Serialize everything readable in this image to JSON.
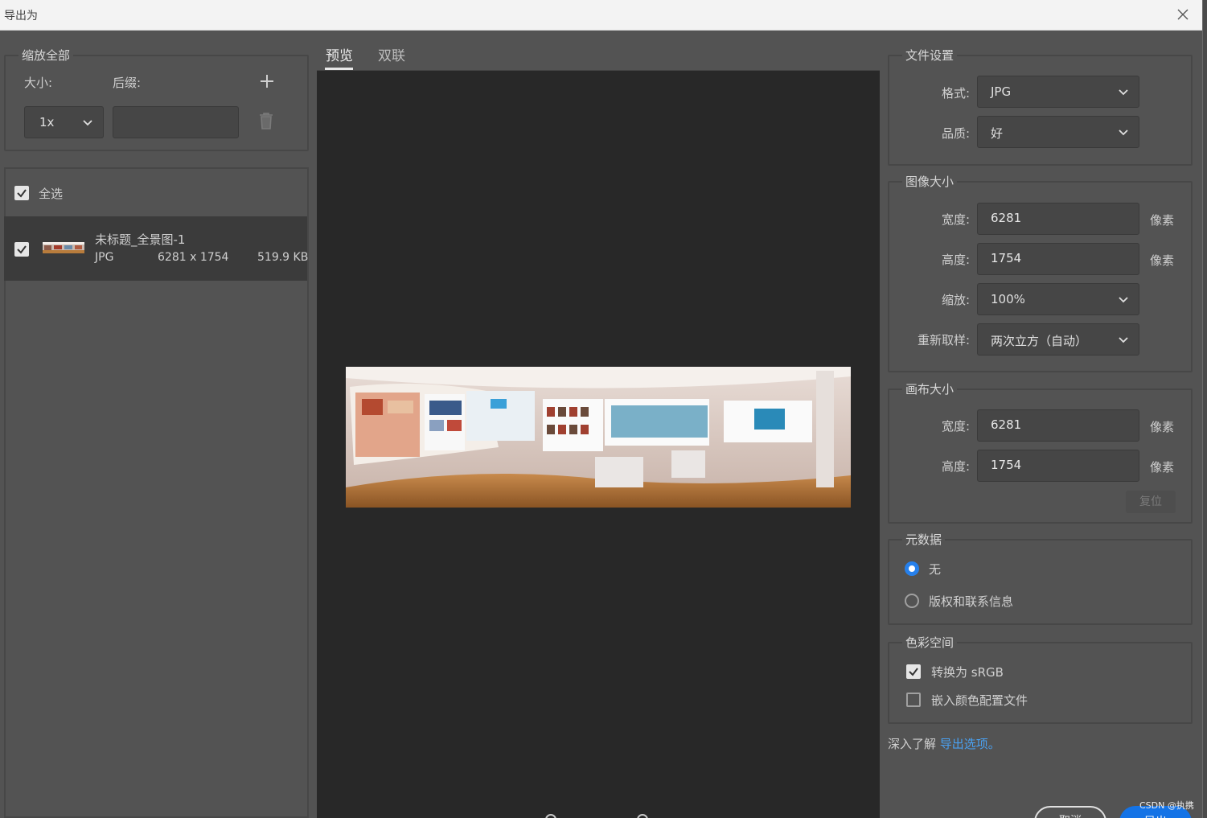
{
  "window": {
    "title": "导出为"
  },
  "scale_all": {
    "legend": "缩放全部",
    "size_label": "大小:",
    "suffix_label": "后缀:",
    "size_value": "1x",
    "suffix_value": ""
  },
  "assets": {
    "select_all_label": "全选",
    "select_all_checked": true,
    "items": [
      {
        "name": "未标题_全景图-1",
        "format": "JPG",
        "dimensions": "6281 x 1754",
        "filesize": "519.9 KB",
        "checked": true
      }
    ]
  },
  "tabs": [
    {
      "label": "预览",
      "active": true
    },
    {
      "label": "双联",
      "active": false
    }
  ],
  "file_settings": {
    "legend": "文件设置",
    "format_label": "格式:",
    "format_value": "JPG",
    "quality_label": "品质:",
    "quality_value": "好"
  },
  "image_size": {
    "legend": "图像大小",
    "width_label": "宽度:",
    "width_value": "6281",
    "height_label": "高度:",
    "height_value": "1754",
    "unit": "像素",
    "scale_label": "缩放:",
    "scale_value": "100%",
    "resample_label": "重新取样:",
    "resample_value": "两次立方（自动）"
  },
  "canvas_size": {
    "legend": "画布大小",
    "width_label": "宽度:",
    "width_value": "6281",
    "height_label": "高度:",
    "height_value": "1754",
    "unit": "像素",
    "reset_label": "复位"
  },
  "metadata": {
    "legend": "元数据",
    "options": [
      {
        "label": "无",
        "selected": true
      },
      {
        "label": "版权和联系信息",
        "selected": false
      }
    ]
  },
  "color_space": {
    "legend": "色彩空间",
    "convert_srgb_label": "转换为 sRGB",
    "convert_srgb_checked": true,
    "embed_profile_label": "嵌入颜色配置文件",
    "embed_profile_checked": false
  },
  "learn_more": {
    "prefix": "深入了解",
    "link": "导出选项。"
  },
  "footer": {
    "cancel_label": "取消",
    "export_label": "导出"
  },
  "watermark": "CSDN @执携",
  "colors": {
    "accent": "#2680eb",
    "link": "#4aa0f0",
    "panel": "#535353",
    "preview_bg": "#282828"
  }
}
